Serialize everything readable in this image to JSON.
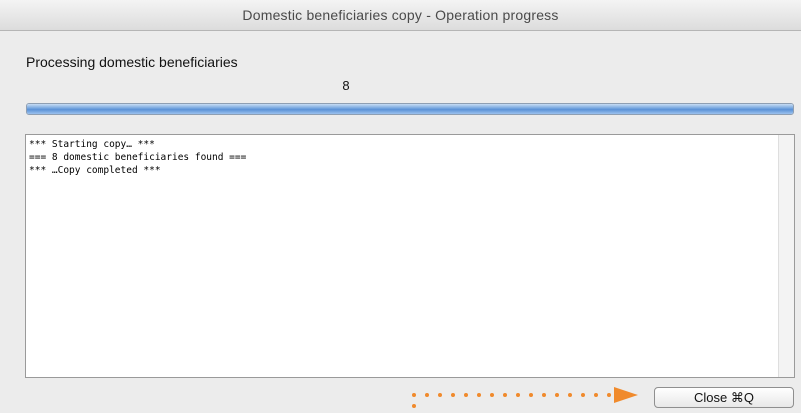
{
  "window": {
    "title": "Domestic beneficiaries copy - Operation progress"
  },
  "status": {
    "label": "Processing domestic beneficiaries",
    "count": "8"
  },
  "progress": {
    "percent": 100,
    "color": "#5a91d6"
  },
  "log": {
    "lines": [
      "*** Starting copy… ***",
      "=== 8 domestic beneficiaries found ===",
      "*** …Copy completed ***"
    ]
  },
  "buttons": {
    "close_label": "Close ⌘Q"
  },
  "annotation": {
    "color": "#f08a2c"
  }
}
